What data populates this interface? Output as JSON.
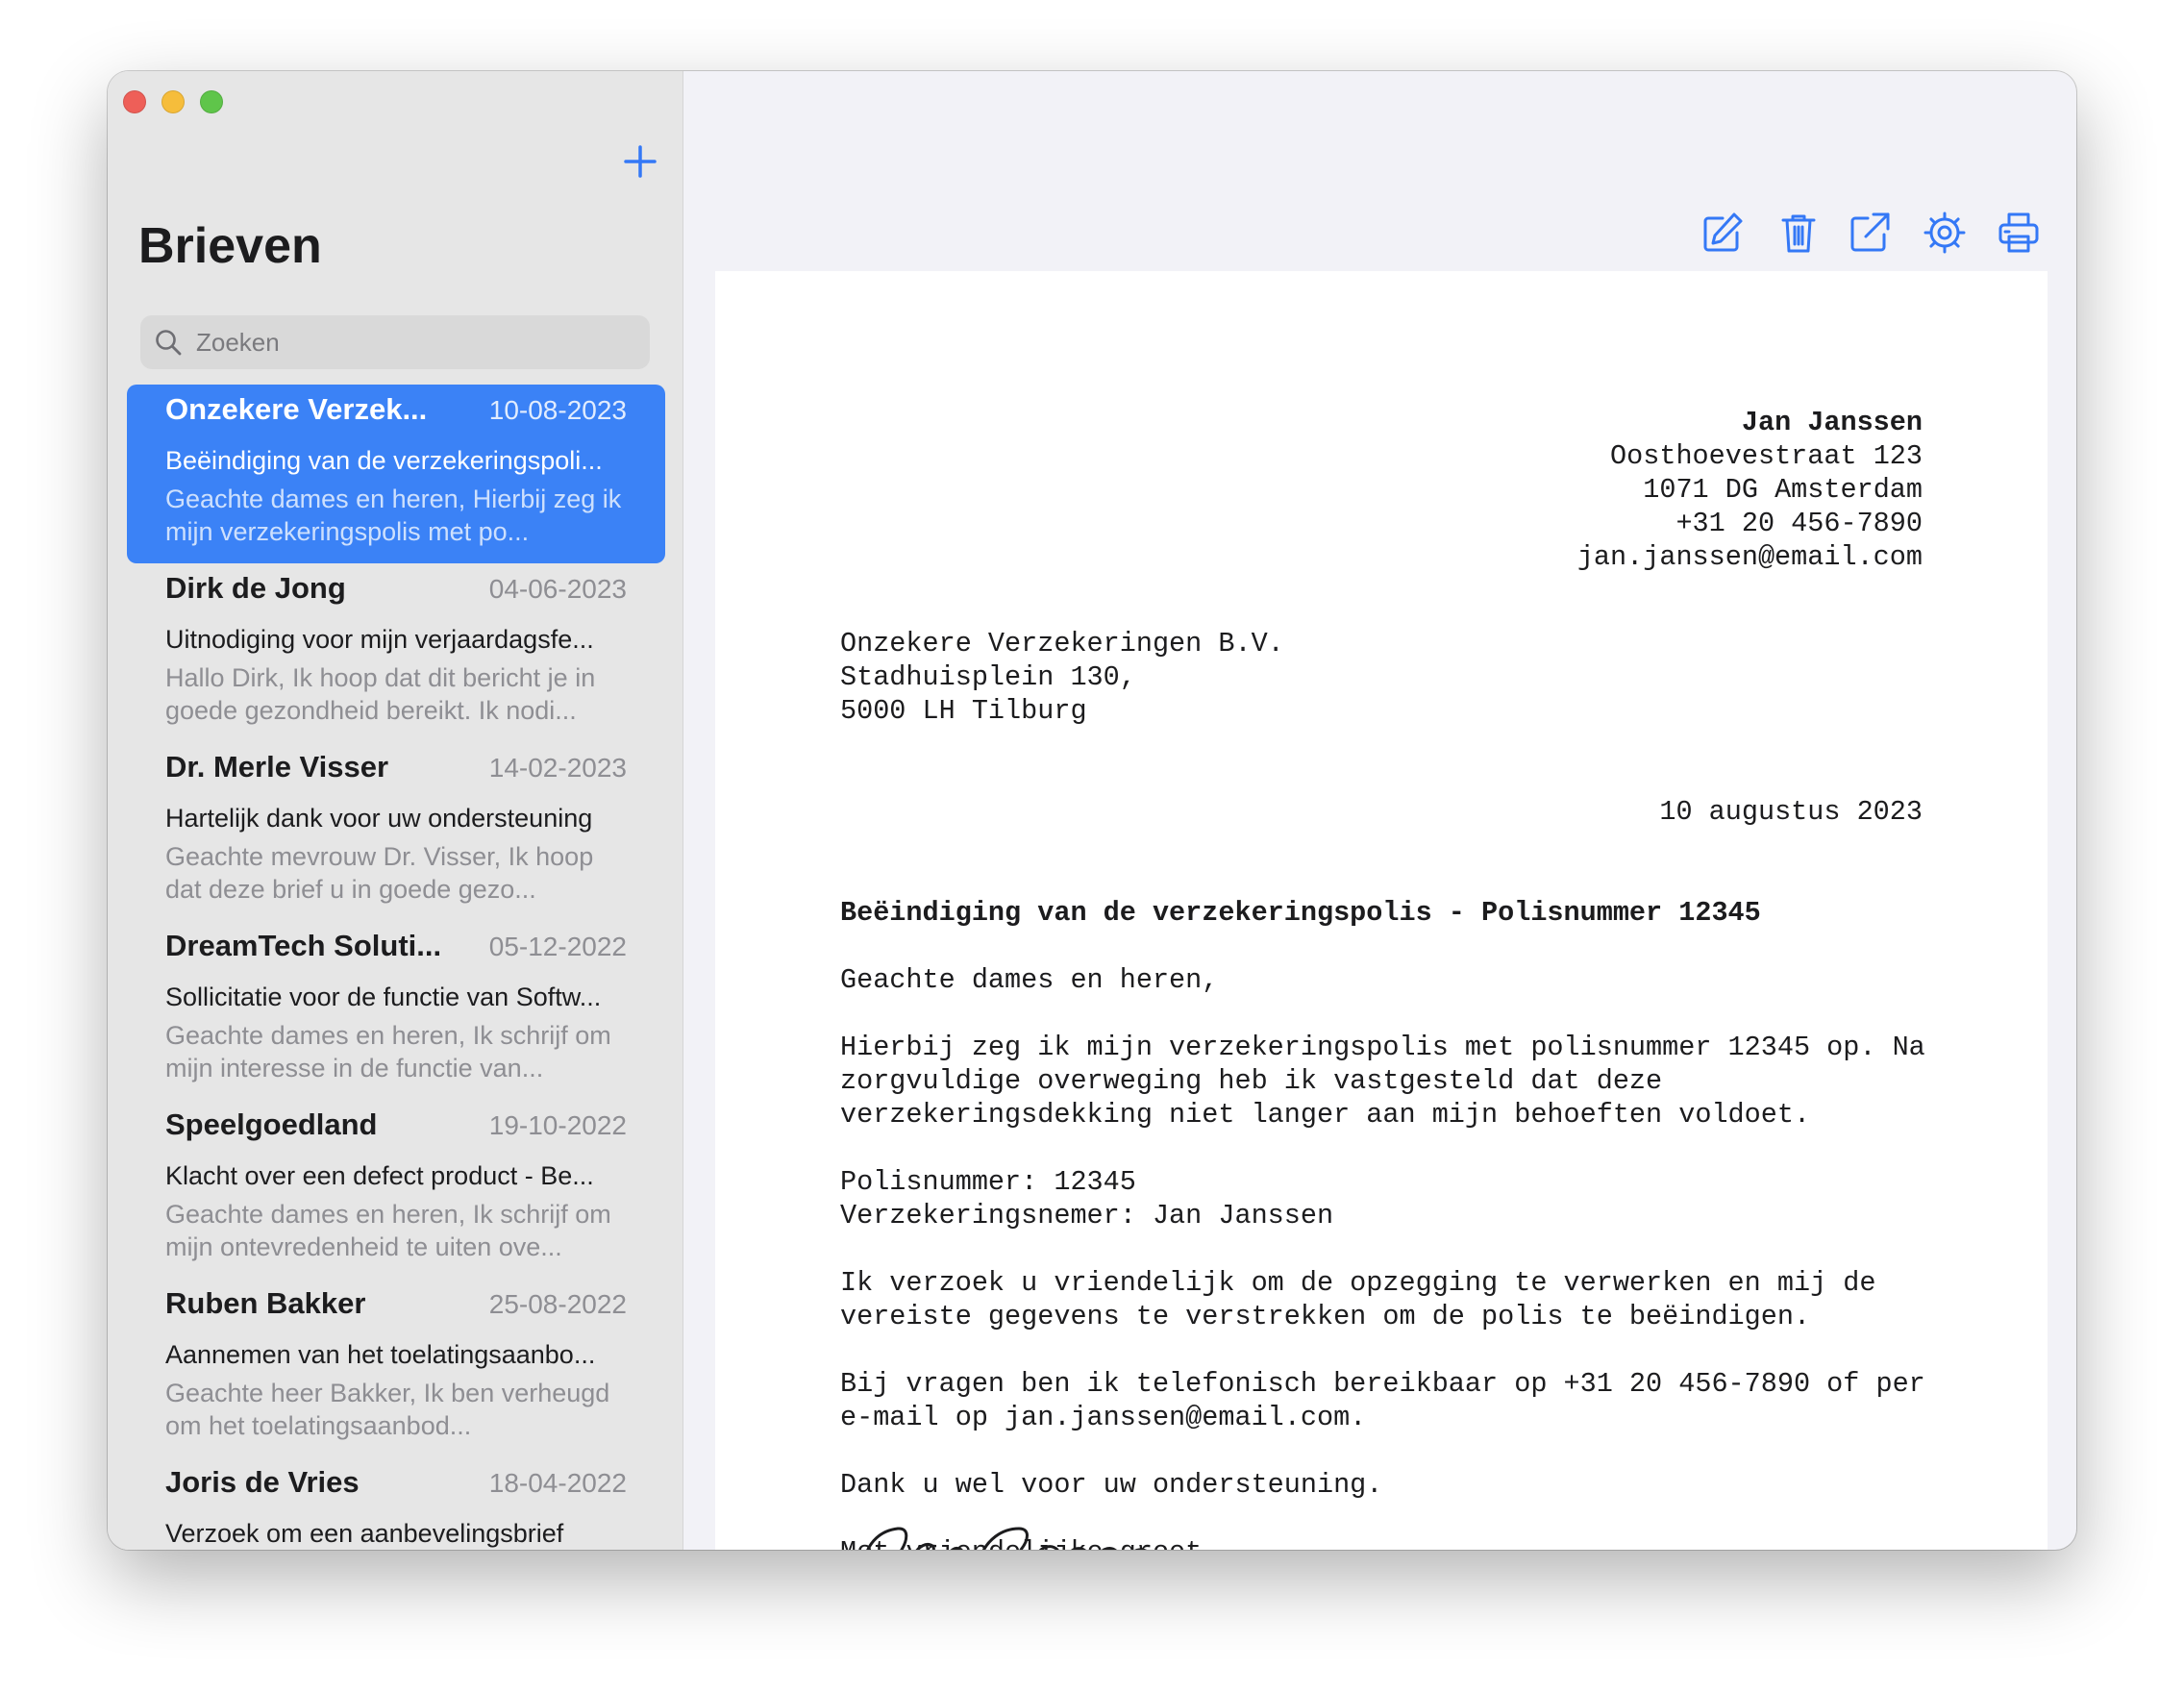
{
  "window": {
    "controls": [
      "close",
      "minimize",
      "maximize"
    ]
  },
  "sidebar": {
    "title": "Brieven",
    "add_icon": "plus-icon",
    "search": {
      "placeholder": "Zoeken",
      "value": "",
      "icon": "search-icon"
    },
    "letters": [
      {
        "sender": "Onzekere Verzek...",
        "date": "10-08-2023",
        "subject": "Beëindiging van de verzekeringspoli...",
        "preview": "Geachte dames en heren,  Hierbij zeg ik mijn verzekeringspolis met po...",
        "selected": true
      },
      {
        "sender": "Dirk de Jong",
        "date": "04-06-2023",
        "subject": "Uitnodiging voor mijn verjaardagsfe...",
        "preview": "Hallo Dirk,  Ik hoop dat dit bericht je in goede gezondheid bereikt. Ik nodi...",
        "selected": false
      },
      {
        "sender": "Dr. Merle Visser",
        "date": "14-02-2023",
        "subject": "Hartelijk dank voor uw ondersteuning",
        "preview": "Geachte mevrouw Dr. Visser,  Ik hoop dat deze brief u in goede gezo...",
        "selected": false
      },
      {
        "sender": "DreamTech Soluti...",
        "date": "05-12-2022",
        "subject": "Sollicitatie voor de functie van Softw...",
        "preview": "Geachte dames en heren,  Ik schrijf om mijn interesse in de functie van...",
        "selected": false
      },
      {
        "sender": "Speelgoedland",
        "date": "19-10-2022",
        "subject": "Klacht over een defect product - Be...",
        "preview": "Geachte dames en heren,  Ik schrijf om mijn ontevredenheid te uiten ove...",
        "selected": false
      },
      {
        "sender": "Ruben Bakker",
        "date": "25-08-2022",
        "subject": "Aannemen van het toelatingsaanbo...",
        "preview": "Geachte heer Bakker,  Ik ben verheugd om het toelatingsaanbod...",
        "selected": false
      },
      {
        "sender": "Joris de Vries",
        "date": "18-04-2022",
        "subject": "Verzoek om een aanbevelingsbrief",
        "preview": "",
        "selected": false
      }
    ]
  },
  "toolbar": {
    "tools": [
      {
        "name": "edit-icon"
      },
      {
        "name": "trash-icon"
      },
      {
        "name": "share-icon"
      },
      {
        "name": "gear-icon"
      },
      {
        "name": "printer-icon"
      }
    ],
    "accent": "#3478f6"
  },
  "letter": {
    "sender": {
      "name": "Jan Janssen",
      "street": "Oosthoevestraat 123",
      "city": "1071 DG Amsterdam",
      "phone": "+31 20 456-7890",
      "email": "jan.janssen@email.com"
    },
    "recipient": {
      "name": "Onzekere Verzekeringen B.V.",
      "street": "Stadhuisplein 130,",
      "city": "5000 LH Tilburg"
    },
    "date": "10 augustus 2023",
    "subject": "Beëindiging van de verzekeringspolis - Polisnummer 12345",
    "salutation": "Geachte dames en heren,",
    "para1": "Hierbij zeg ik mijn verzekeringspolis met polisnummer 12345 op. Na zorgvuldige overweging heb ik vastgesteld dat deze verzekeringsdekking niet langer aan mijn behoeften voldoet.",
    "policy_line": "Polisnummer: 12345",
    "holder_line": "Verzekeringsnemer: Jan Janssen",
    "para2": "Ik verzoek u vriendelijk om de opzegging te verwerken en mij de vereiste gegevens te verstrekken om de polis te beëindigen.",
    "para3": "Bij vragen ben ik telefonisch bereikbaar op +31 20 456-7890 of per e-mail op jan.janssen@email.com.",
    "thanks": "Dank u wel voor uw ondersteuning.",
    "closing": "Met vriendelijke groet,",
    "signature": "Jan Janssen"
  }
}
